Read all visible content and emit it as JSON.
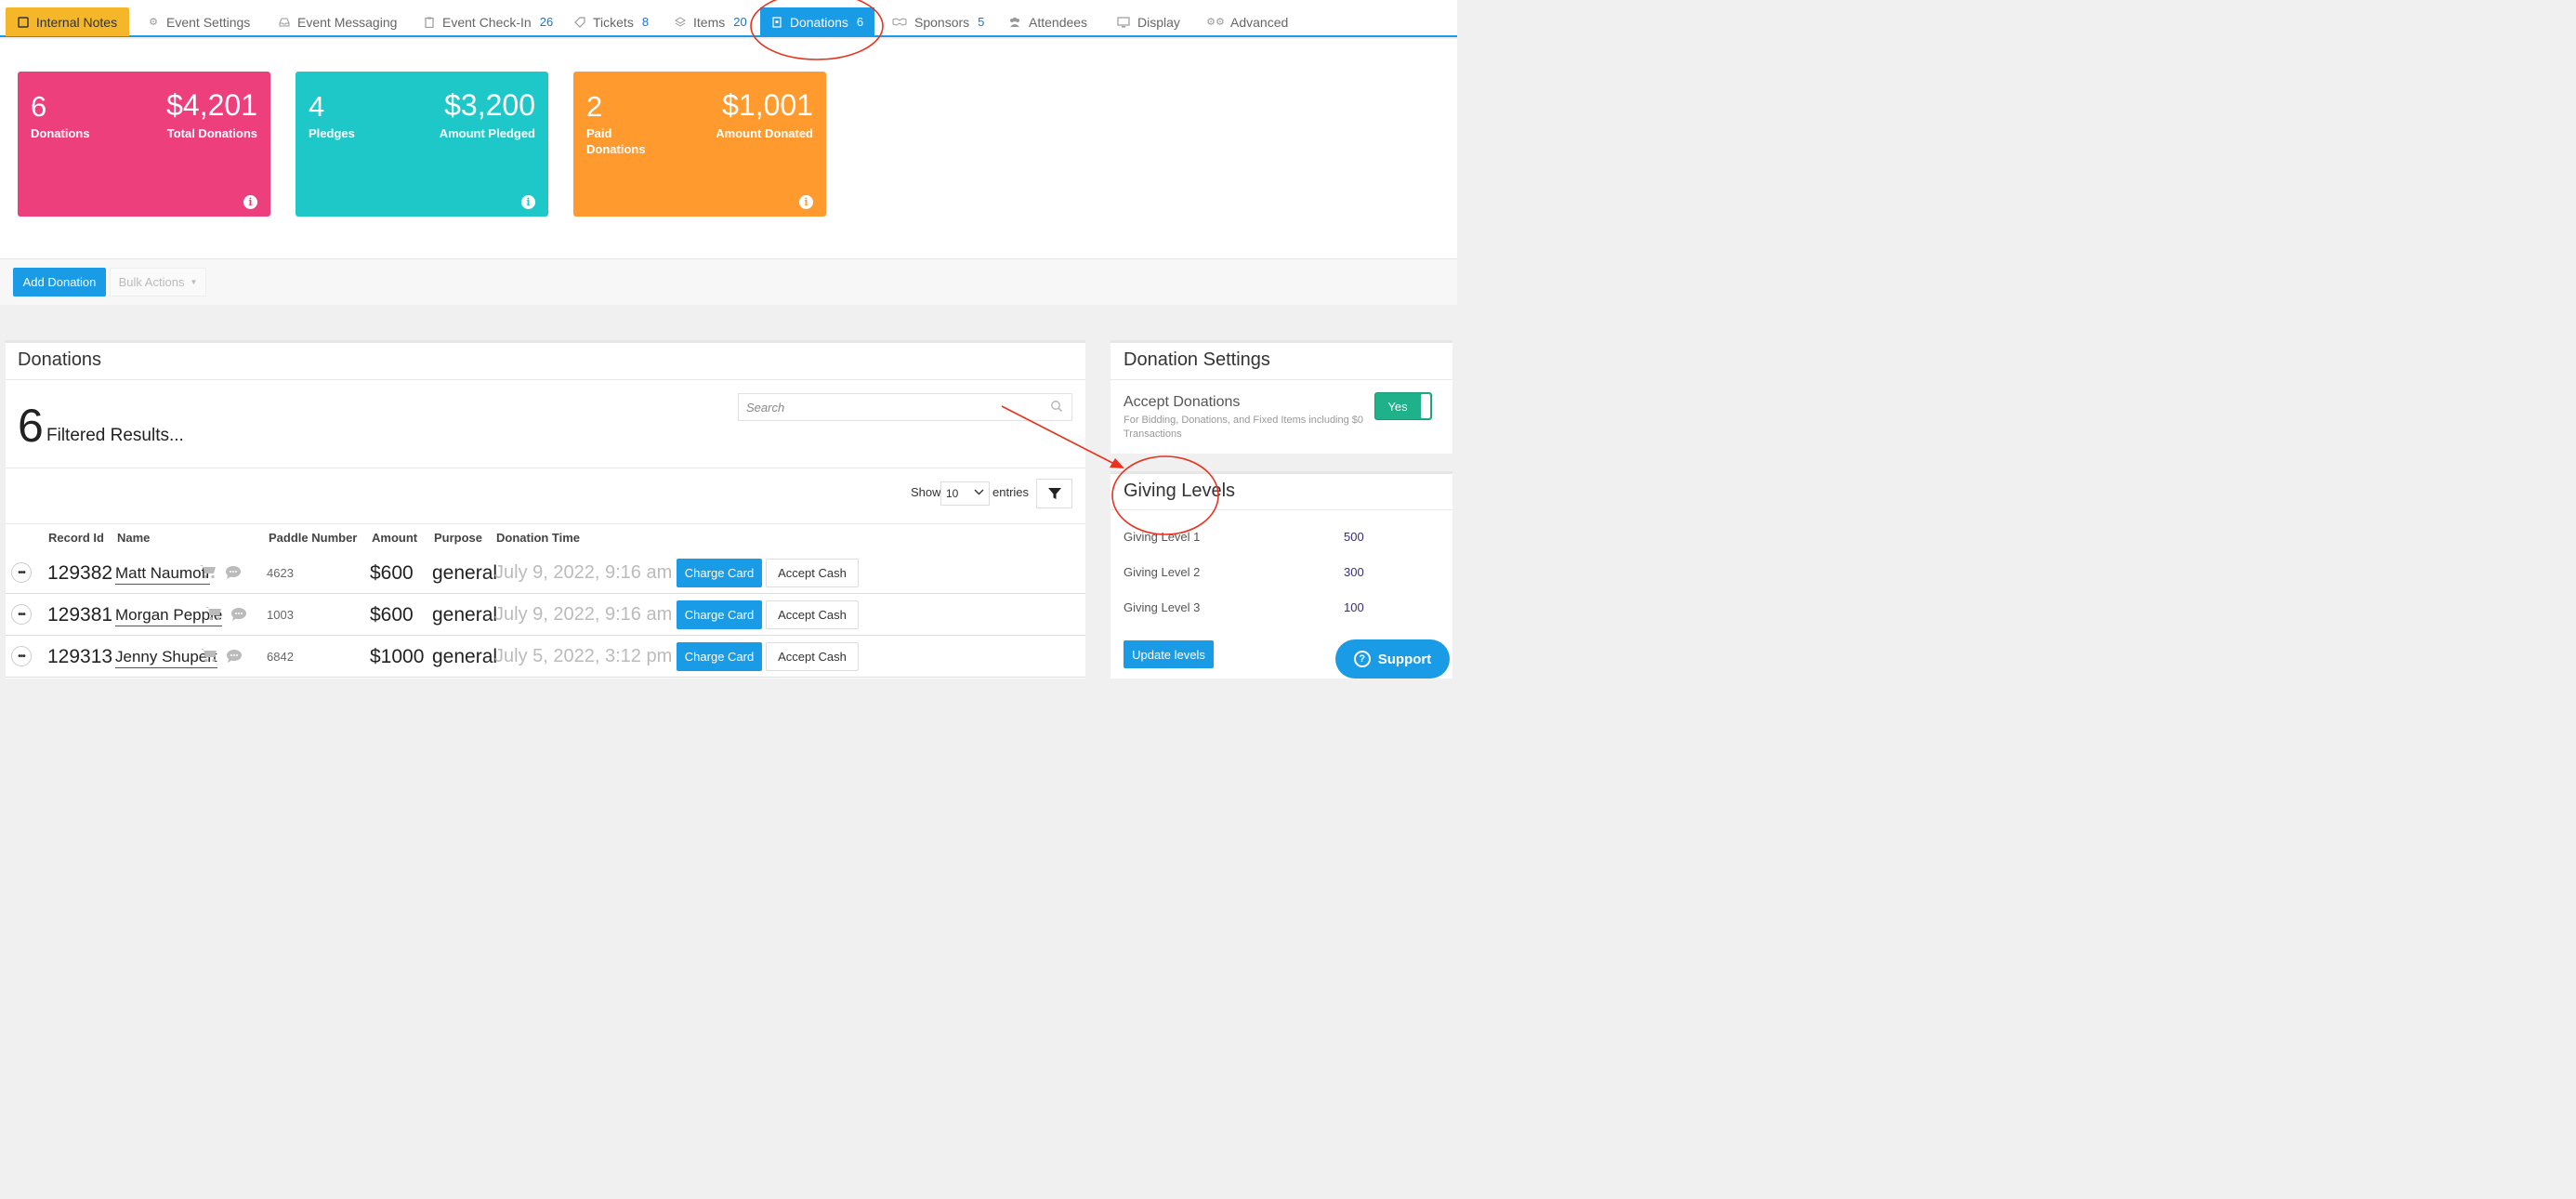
{
  "tabs": [
    {
      "label": "Internal Notes",
      "icon": "note-icon",
      "count": ""
    },
    {
      "label": "Event Settings",
      "icon": "gear-icon",
      "count": ""
    },
    {
      "label": "Event Messaging",
      "icon": "inbox-icon",
      "count": ""
    },
    {
      "label": "Event Check-In",
      "icon": "clipboard-icon",
      "count": "26"
    },
    {
      "label": "Tickets",
      "icon": "ticket-icon",
      "count": "8"
    },
    {
      "label": "Items",
      "icon": "layers-icon",
      "count": "20"
    },
    {
      "label": "Donations",
      "icon": "donation-icon",
      "count": "6"
    },
    {
      "label": "Sponsors",
      "icon": "handshake-icon",
      "count": "5"
    },
    {
      "label": "Attendees",
      "icon": "users-icon",
      "count": ""
    },
    {
      "label": "Display",
      "icon": "monitor-icon",
      "count": ""
    },
    {
      "label": "Advanced",
      "icon": "cogs-icon",
      "count": ""
    }
  ],
  "cards": [
    {
      "num": "6",
      "label": "Donations",
      "amount": "$4,201",
      "amount_label": "Total Donations",
      "color": "#ee3f7d"
    },
    {
      "num": "4",
      "label": "Pledges",
      "amount": "$3,200",
      "amount_label": "Amount Pledged",
      "color": "#1fc8c8"
    },
    {
      "num": "2",
      "label": "Paid Donations",
      "amount": "$1,001",
      "amount_label": "Amount Donated",
      "color": "#ff9a2f"
    }
  ],
  "actions": {
    "add_label": "Add Donation",
    "bulk_label": "Bulk Actions"
  },
  "donations": {
    "title": "Donations",
    "result_count": "6",
    "result_label": "Filtered Results...",
    "search_placeholder": "Search",
    "show_label": "Show",
    "entries_value": "10",
    "entries_label": "entries",
    "columns": [
      "Record Id",
      "Name",
      "Paddle Number",
      "Amount",
      "Purpose",
      "Donation Time"
    ],
    "rows": [
      {
        "id": "129382",
        "name": "Matt Naumoff",
        "paddle": "4623",
        "amount": "$600",
        "purpose": "general",
        "time": "July 9, 2022, 9:16 am"
      },
      {
        "id": "129381",
        "name": "Morgan Pepple",
        "paddle": "1003",
        "amount": "$600",
        "purpose": "general",
        "time": "July 9, 2022, 9:16 am"
      },
      {
        "id": "129313",
        "name": "Jenny Shupert",
        "paddle": "6842",
        "amount": "$1000",
        "purpose": "general",
        "time": "July 5, 2022, 3:12 pm"
      }
    ],
    "charge_label": "Charge Card",
    "cash_label": "Accept Cash"
  },
  "settings": {
    "title": "Donation Settings",
    "accept_title": "Accept Donations",
    "accept_desc": "For Bidding, Donations, and Fixed Items including $0 Transactions",
    "toggle_label": "Yes"
  },
  "giving": {
    "title": "Giving Levels",
    "levels": [
      {
        "name": "Giving Level 1",
        "value": "500"
      },
      {
        "name": "Giving Level 2",
        "value": "300"
      },
      {
        "name": "Giving Level 3",
        "value": "100"
      }
    ],
    "update_label": "Update levels"
  },
  "support_label": "Support"
}
